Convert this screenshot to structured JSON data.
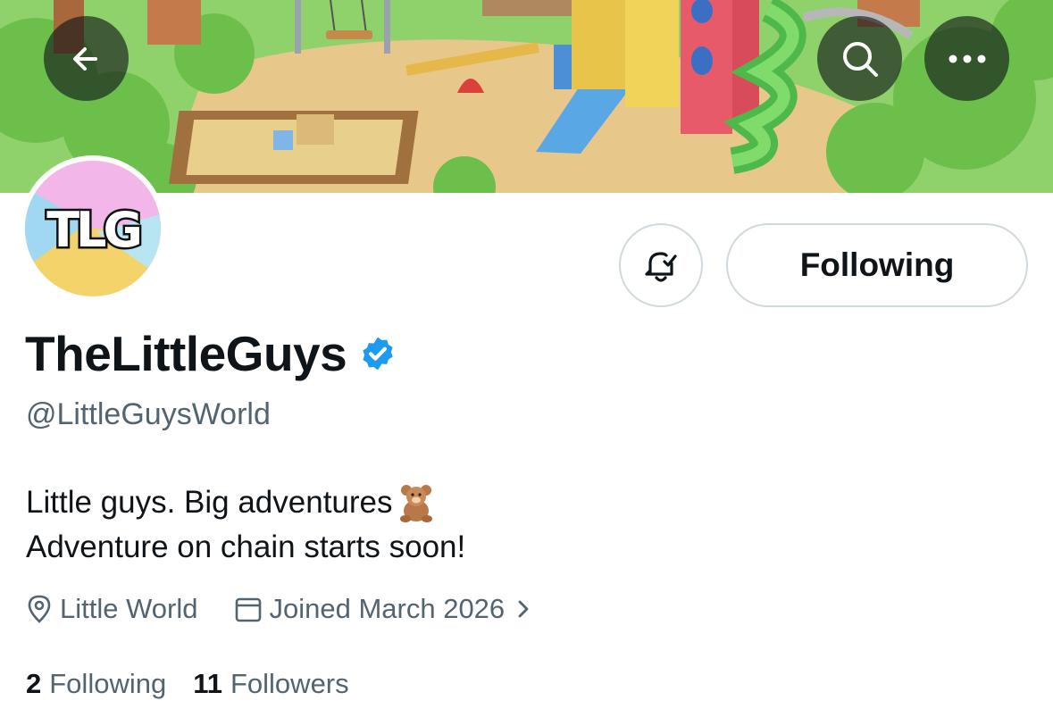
{
  "header": {
    "back_icon": "arrow-left-icon",
    "search_icon": "search-icon",
    "more_icon": "more-horizontal-icon"
  },
  "avatar": {
    "logo_text": "TLG"
  },
  "actions": {
    "notify_icon": "bell-check-icon",
    "following_label": "Following"
  },
  "profile": {
    "display_name": "TheLittleGuys",
    "verified_icon": "verified-badge-icon",
    "handle": "@LittleGuysWorld",
    "bio_line1": "Little guys. Big adventures",
    "bio_emoji": "teddy-bear-emoji",
    "bio_line2": "Adventure on chain starts soon!",
    "location": "Little World",
    "joined": "Joined March 2026"
  },
  "stats": {
    "following_count": "2",
    "following_label": "Following",
    "followers_count": "11",
    "followers_label": "Followers"
  },
  "colors": {
    "verified_blue": "#1d9bf0",
    "secondary_text": "#536471",
    "border": "#cfd9de"
  }
}
